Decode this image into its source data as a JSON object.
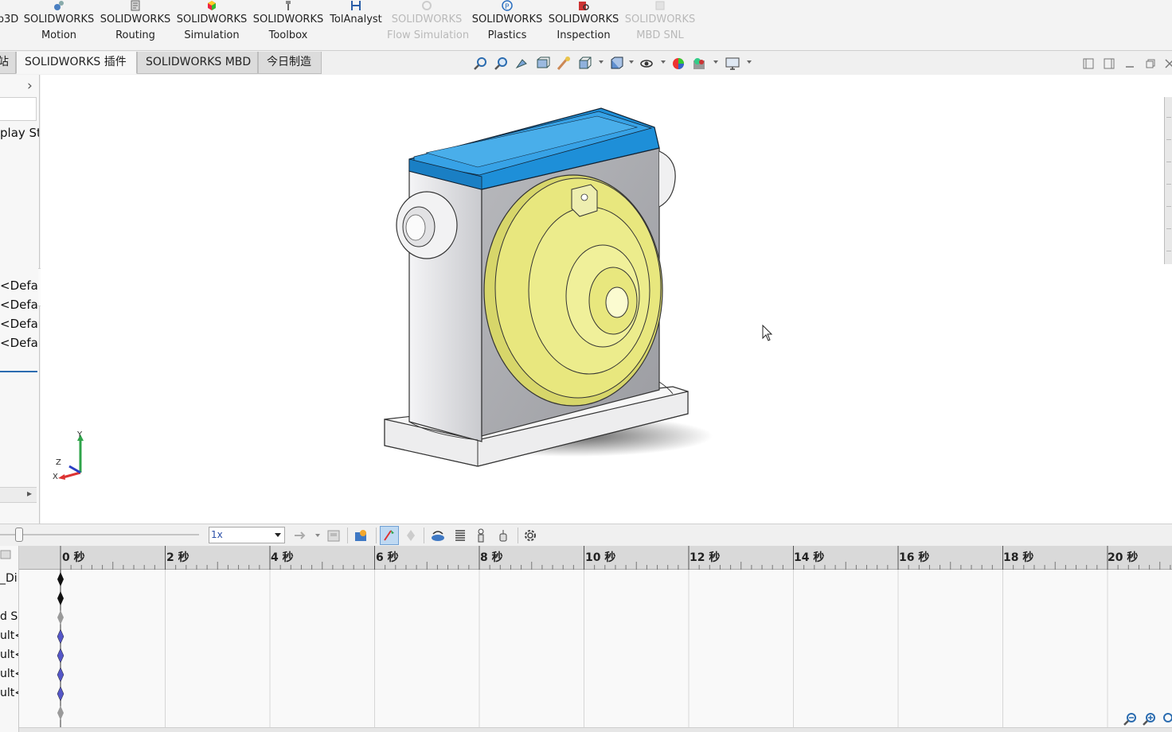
{
  "ribbon": {
    "items": [
      {
        "line1": "b3D",
        "line2": "",
        "disabled": false
      },
      {
        "line1": "SOLIDWORKS",
        "line2": "Motion",
        "disabled": false
      },
      {
        "line1": "SOLIDWORKS",
        "line2": "Routing",
        "disabled": false
      },
      {
        "line1": "SOLIDWORKS",
        "line2": "Simulation",
        "disabled": false
      },
      {
        "line1": "SOLIDWORKS",
        "line2": "Toolbox",
        "disabled": false
      },
      {
        "line1": "TolAnalyst",
        "line2": "",
        "disabled": false
      },
      {
        "line1": "SOLIDWORKS",
        "line2": "Flow Simulation",
        "disabled": true
      },
      {
        "line1": "SOLIDWORKS",
        "line2": "Plastics",
        "disabled": false
      },
      {
        "line1": "SOLIDWORKS",
        "line2": "Inspection",
        "disabled": false
      },
      {
        "line1": "SOLIDWORKS",
        "line2": "MBD SNL",
        "disabled": true
      }
    ]
  },
  "tabs": [
    {
      "label": "站"
    },
    {
      "label": "SOLIDWORKS 插件"
    },
    {
      "label": "SOLIDWORKS MBD"
    },
    {
      "label": "今日制造"
    }
  ],
  "left_panel": {
    "chevron": "›",
    "display_state": "play St",
    "configs": [
      "<Defau",
      "<Defau",
      "<Defau",
      "<Defau"
    ],
    "scroll_arrow": "▸"
  },
  "triad": {
    "x": "X",
    "y": "Y",
    "z": "Z"
  },
  "motion": {
    "speed": "1x",
    "tree_rows": [
      "_Di",
      "",
      "d S",
      "ult<",
      "ult<",
      "ult<",
      "ult<"
    ],
    "time_labels": [
      "0 秒",
      "2 秒",
      "4 秒",
      "6 秒",
      "8 秒",
      "10 秒",
      "12 秒",
      "14 秒",
      "16 秒",
      "18 秒",
      "20 秒"
    ]
  },
  "colors": {
    "cover_blue": "#1e8fd8",
    "body_grey": "#d9dadd",
    "disk_yellow": "#e8e77e",
    "key_black": "#111111",
    "key_grey": "#9a9a9a",
    "key_blue": "#5557c8"
  }
}
